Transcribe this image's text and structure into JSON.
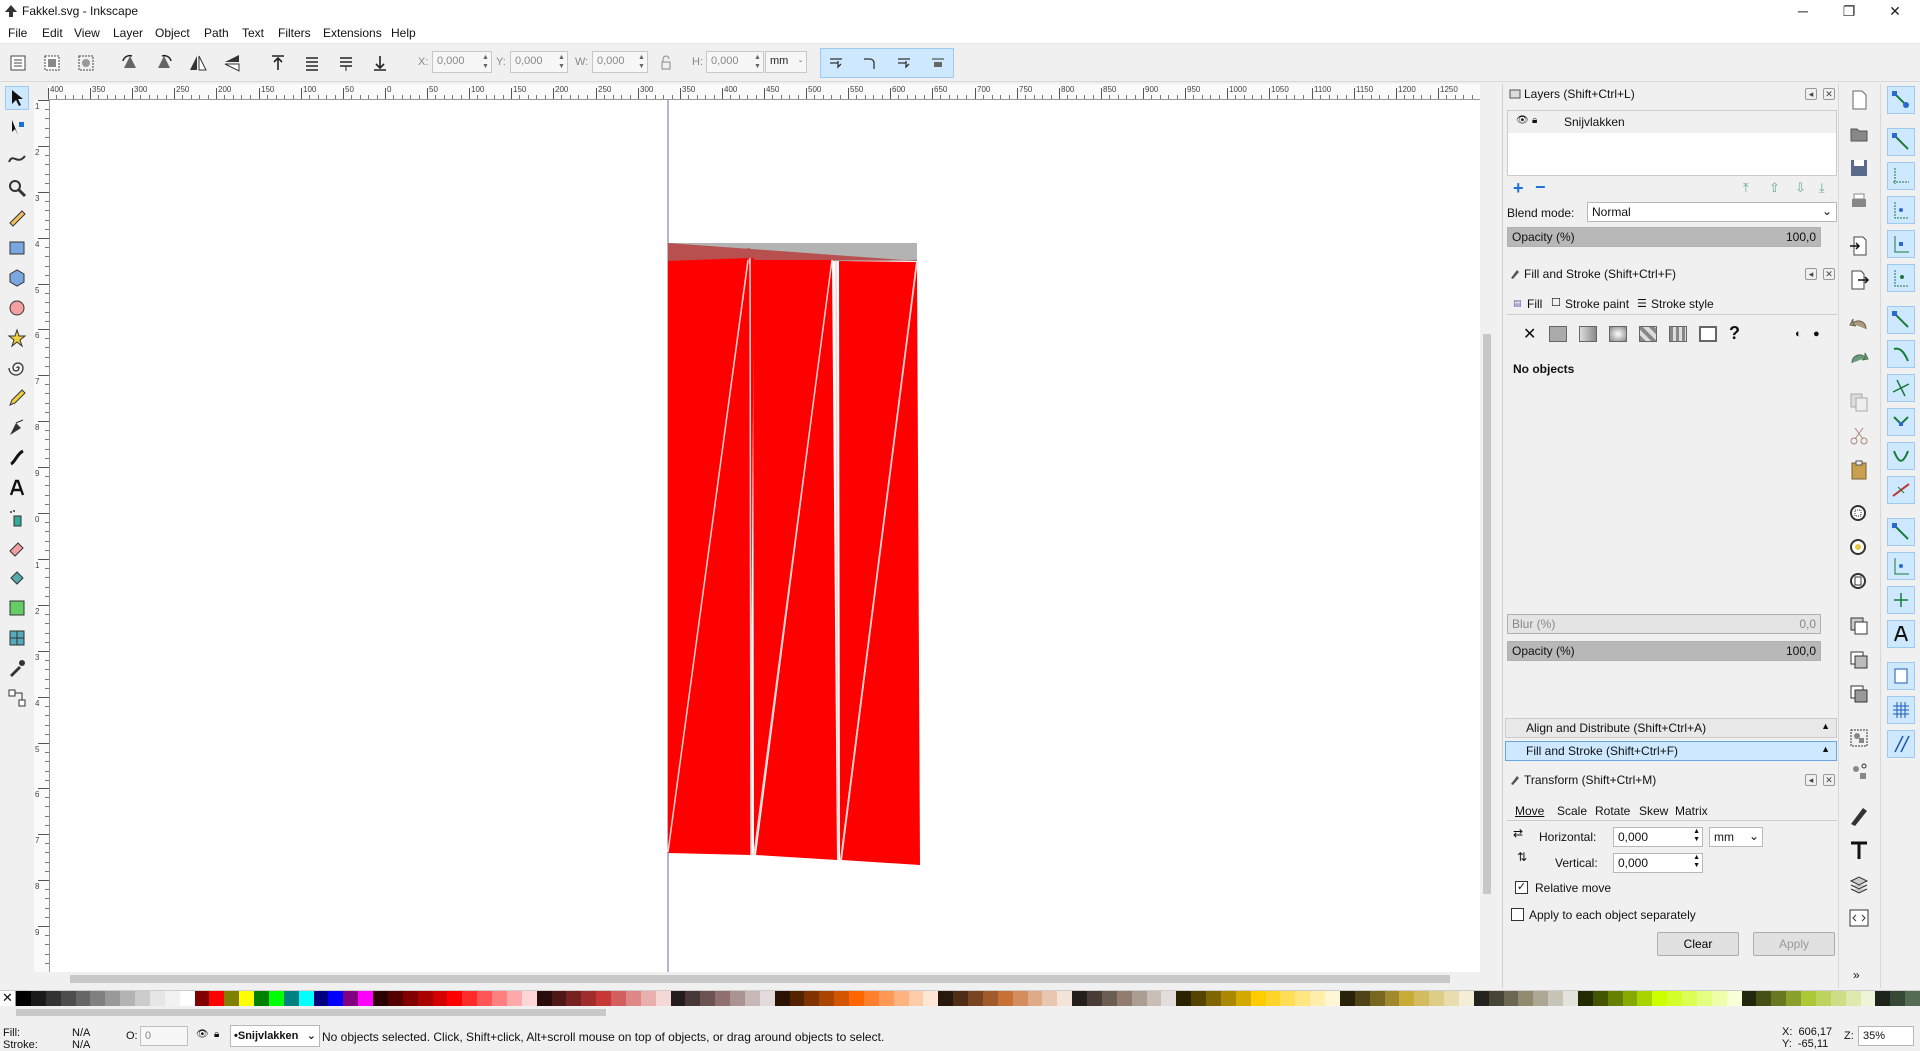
{
  "window": {
    "title": "Fakkel.svg - Inkscape",
    "minimize": "─",
    "restore": "❐",
    "close": "✕"
  },
  "menu": [
    "File",
    "Edit",
    "View",
    "Layer",
    "Object",
    "Path",
    "Text",
    "Filters",
    "Extensions",
    "Help"
  ],
  "toolbar": {
    "x_label": "X:",
    "x_value": "0,000",
    "y_label": "Y:",
    "y_value": "0,000",
    "w_label": "W:",
    "w_value": "0,000",
    "h_label": "H:",
    "h_value": "0,000",
    "unit": "mm"
  },
  "ruler": {
    "h_ticks": [
      "400",
      "350",
      "300",
      "250",
      "200",
      "150",
      "100",
      "50",
      "0",
      "50",
      "100",
      "150",
      "200",
      "250",
      "300",
      "350",
      "400",
      "450",
      "500",
      "550",
      "600",
      "650",
      "700",
      "750",
      "800",
      "850",
      "900",
      "950",
      "1000",
      "1050",
      "1100",
      "1150",
      "1200",
      "1250"
    ],
    "v_ticks": [
      "1",
      "2",
      "3",
      "4",
      "5",
      "6",
      "7",
      "8",
      "9",
      "0",
      "1",
      "2",
      "3",
      "4",
      "5",
      "6",
      "7",
      "8",
      "9"
    ]
  },
  "layers_panel": {
    "title": "Layers (Shift+Ctrl+L)",
    "layer_name": "Snijvlakken",
    "blend_label": "Blend mode:",
    "blend_value": "Normal",
    "opacity_label": "Opacity (%)",
    "opacity_value": "100,0"
  },
  "fill_stroke_panel": {
    "title": "Fill and Stroke (Shift+Ctrl+F)",
    "tab_fill": "Fill",
    "tab_stroke_paint": "Stroke paint",
    "tab_stroke_style": "Stroke style",
    "unknown_glyph": "?",
    "status": "No objects",
    "blur_label": "Blur (%)",
    "blur_value": "0,0",
    "opacity_label": "Opacity (%)",
    "opacity_value": "100,0"
  },
  "collapsed_panels": {
    "align": "Align and Distribute (Shift+Ctrl+A)",
    "fill": "Fill and Stroke (Shift+Ctrl+F)"
  },
  "transform_panel": {
    "title": "Transform (Shift+Ctrl+M)",
    "tabs": [
      "Move",
      "Scale",
      "Rotate",
      "Skew",
      "Matrix"
    ],
    "horizontal_label": "Horizontal:",
    "horizontal_value": "0,000",
    "unit": "mm",
    "vertical_label": "Vertical:",
    "vertical_value": "0,000",
    "relative_move": "Relative move",
    "relative_move_checked": true,
    "apply_each": "Apply to each object separately",
    "apply_each_checked": false,
    "clear": "Clear",
    "apply": "Apply"
  },
  "statusbar": {
    "fill_label": "Fill:",
    "fill_value": "N/A",
    "stroke_label": "Stroke:",
    "stroke_value": "N/A",
    "o_label": "O:",
    "o_value": "0",
    "layer": "•Snijvlakken",
    "message": "No objects selected. Click, Shift+click, Alt+scroll mouse on top of objects, or drag around objects to select.",
    "x_coord": "X:  606,17",
    "y_coord": "Y:  -65,11",
    "z_label": "Z:",
    "zoom": "35%"
  },
  "palette": [
    "#000000",
    "#1a1a1a",
    "#333333",
    "#4d4d4d",
    "#666666",
    "#808080",
    "#999999",
    "#b3b3b3",
    "#cccccc",
    "#e6e6e6",
    "#f2f2f2",
    "#ffffff",
    "#800000",
    "#ff0000",
    "#808000",
    "#ffff00",
    "#008000",
    "#00ff00",
    "#008080",
    "#00ffff",
    "#000080",
    "#0000ff",
    "#800080",
    "#ff00ff",
    "#2b0000",
    "#550000",
    "#800000",
    "#aa0000",
    "#d40000",
    "#ff0000",
    "#ff2a2a",
    "#ff5555",
    "#ff8080",
    "#ffaaaa",
    "#ffd5d5",
    "#280b0b",
    "#501616",
    "#782121",
    "#a02c2c",
    "#c83737",
    "#d35f5f",
    "#de8787",
    "#e9afaf",
    "#f4d7d7",
    "#241c1c",
    "#483737",
    "#6c5353",
    "#916f6f",
    "#ac9393",
    "#c8b7b7",
    "#e3dbdb",
    "#2b1100",
    "#552200",
    "#803300",
    "#aa4400",
    "#d45500",
    "#ff6600",
    "#ff7f2a",
    "#ff9955",
    "#ffb380",
    "#ffccaa",
    "#ffe6d5",
    "#28170b",
    "#502d16",
    "#784421",
    "#a05a2c",
    "#c87137",
    "#d38d5f",
    "#deaa87",
    "#e9c6af",
    "#f4e3d7",
    "#241f1c",
    "#483e37",
    "#6c5d53",
    "#917c6f",
    "#ac9d93",
    "#c8beb7",
    "#e3dedb",
    "#2b2200",
    "#554400",
    "#806600",
    "#aa8800",
    "#d4aa00",
    "#ffcc00",
    "#ffd42a",
    "#ffdd55",
    "#ffe680",
    "#ffeeaa",
    "#fff6d5",
    "#28220b",
    "#504416",
    "#786721",
    "#a0892c",
    "#c8ab37",
    "#d3bc5f",
    "#decd87",
    "#e9ddaf",
    "#f4eed7",
    "#24221c",
    "#484537",
    "#6c6753",
    "#918a6f",
    "#aca793",
    "#c8c4b7",
    "#e3e2db",
    "#222b00",
    "#445500",
    "#668000",
    "#88aa00",
    "#aad400",
    "#ccff00",
    "#d4ff2a",
    "#ddff55",
    "#e5ff80",
    "#eeffaa",
    "#f6ffd5",
    "#22280b",
    "#445016",
    "#677821",
    "#89a02c",
    "#abc837",
    "#bcd35f",
    "#cdde87",
    "#dde9af",
    "#eef4d7",
    "#1c241c",
    "#374837",
    "#536c53"
  ]
}
